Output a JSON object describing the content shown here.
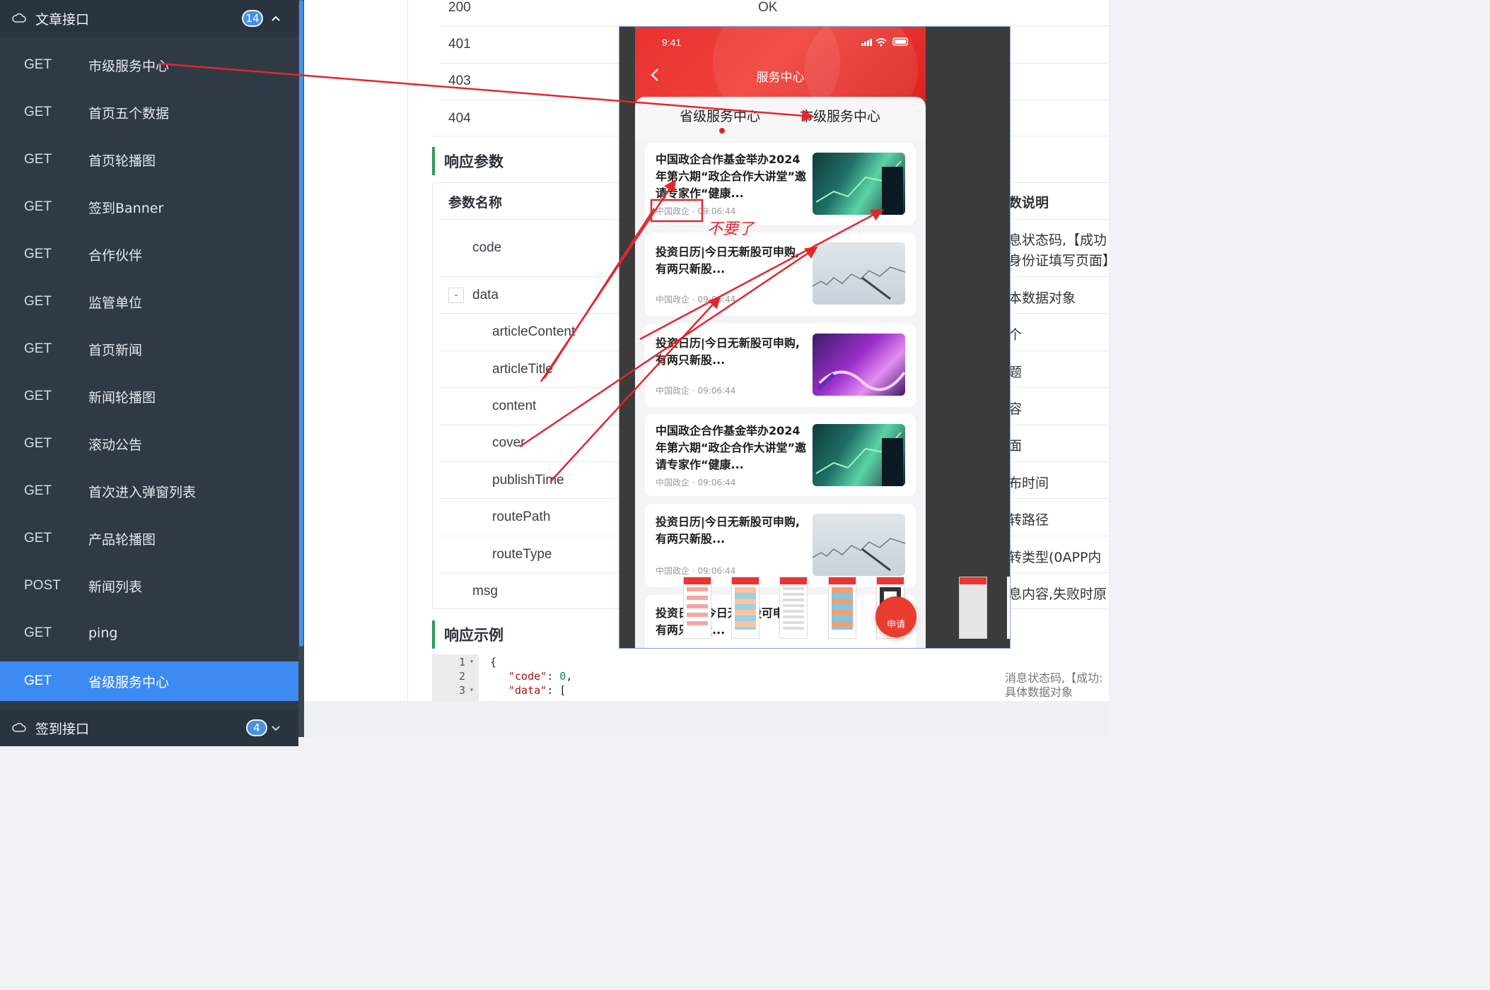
{
  "sidebar": {
    "group1": {
      "title": "文章接口",
      "count": "14"
    },
    "items": [
      {
        "method": "GET",
        "name": "市级服务中心"
      },
      {
        "method": "GET",
        "name": "首页五个数据"
      },
      {
        "method": "GET",
        "name": "首页轮播图"
      },
      {
        "method": "GET",
        "name": "签到Banner"
      },
      {
        "method": "GET",
        "name": "合作伙伴"
      },
      {
        "method": "GET",
        "name": "监管单位"
      },
      {
        "method": "GET",
        "name": "首页新闻"
      },
      {
        "method": "GET",
        "name": "新闻轮播图"
      },
      {
        "method": "GET",
        "name": "滚动公告"
      },
      {
        "method": "GET",
        "name": "首次进入弹窗列表"
      },
      {
        "method": "GET",
        "name": "产品轮播图"
      },
      {
        "method": "POST",
        "name": "新闻列表"
      },
      {
        "method": "GET",
        "name": "ping"
      },
      {
        "method": "GET",
        "name": "省级服务中心"
      }
    ],
    "group2": {
      "title": "签到接口",
      "count": "4"
    }
  },
  "status_codes": [
    {
      "code": "200",
      "desc": "OK"
    },
    {
      "code": "401",
      "desc": ""
    },
    {
      "code": "403",
      "desc": ""
    },
    {
      "code": "404",
      "desc": ""
    }
  ],
  "response_params": {
    "title": "响应参数",
    "header_name": "参数名称",
    "header_desc": "数说明",
    "toggle": "-",
    "rows": [
      {
        "name": "code",
        "desc": "息状态码,【成功"
      },
      {
        "name": "data",
        "desc": "本数据对象"
      },
      {
        "name": "articleContent",
        "desc": "个"
      },
      {
        "name": "articleTitle",
        "desc": "题"
      },
      {
        "name": "content",
        "desc": "容"
      },
      {
        "name": "cover",
        "desc": "面"
      },
      {
        "name": "publishTime",
        "desc": "布时间"
      },
      {
        "name": "routePath",
        "desc": "转路径"
      },
      {
        "name": "routeType",
        "desc": "转类型(0APP内"
      },
      {
        "name": "msg",
        "desc": "息内容,失败时原"
      }
    ],
    "extra_desc": "身份证填写页面】"
  },
  "response_example": {
    "title": "响应示例",
    "lines": [
      {
        "n": "1",
        "fold": "▾",
        "text": "{"
      },
      {
        "n": "2",
        "fold": "",
        "key": "\"code\"",
        "sep": ": ",
        "val": "0",
        "end": ","
      },
      {
        "n": "3",
        "fold": "▾",
        "key": "\"data\"",
        "sep": ": ",
        "val": "[",
        "end": ""
      }
    ],
    "side_notes": [
      "消息状态码,【成功:",
      "具体数据对象"
    ]
  },
  "phone": {
    "time": "9:41",
    "nav_title": "服务中心",
    "tabs": [
      "省级服务中心",
      "市级服务中心"
    ],
    "cards": [
      {
        "title": "中国政企合作基金举办2024年第六期“政企合作大讲堂”邀请专家作“健康...",
        "source": "中国政企",
        "time": "09:06:44",
        "thumb": "finance-chart-man"
      },
      {
        "title": "投资日历|今日无新股可申购,有两只新股...",
        "source": "中国政企",
        "time": "09:06:44",
        "thumb": "stock-chart-pen"
      },
      {
        "title": "投资日历|今日无新股可申购,有两只新股...",
        "source": "中国政企",
        "time": "09:06:44",
        "thumb": "purple-wave"
      },
      {
        "title": "中国政企合作基金举办2024年第六期“政企合作大讲堂”邀请专家作“健康...",
        "source": "中国政企",
        "time": "09:06:44",
        "thumb": "finance-chart-man"
      },
      {
        "title": "投资日历|今日无新股可申购,有两只新股...",
        "source": "中国政企",
        "time": "09:06:44",
        "thumb": "stock-chart-pen"
      },
      {
        "title": "投资日历|今日无新股可申购,有两只新股...",
        "source": "",
        "time": "",
        "thumb": ""
      }
    ],
    "fab_label": "申请",
    "dot_sep": "·"
  },
  "annotation": {
    "note": "不要了",
    "color": "#e3262d"
  },
  "colors": {
    "sidebar_bg": "#2f3a45",
    "active_item": "#3d8bf2",
    "badge": "#4a90e2",
    "section_bar": "#2a9d5a",
    "phone_red": "#e8322f"
  }
}
